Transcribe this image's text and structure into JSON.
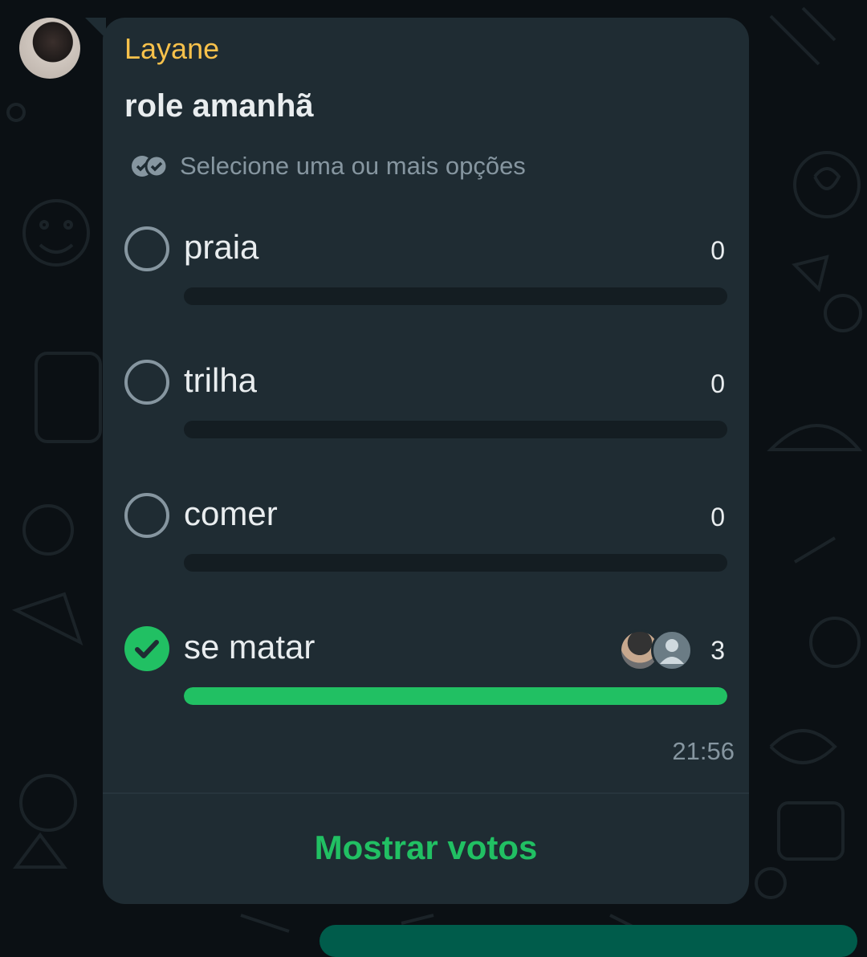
{
  "message": {
    "sender": "Layane",
    "sender_color": "#f7c14b",
    "poll": {
      "question": "role amanhã",
      "hint": "Selecione uma ou mais opções",
      "options": [
        {
          "label": "praia",
          "votes": "0",
          "fill": 0,
          "checked": false
        },
        {
          "label": "trilha",
          "votes": "0",
          "fill": 0,
          "checked": false
        },
        {
          "label": "comer",
          "votes": "0",
          "fill": 0,
          "checked": false
        },
        {
          "label": "se matar",
          "votes": "3",
          "fill": 1,
          "checked": true
        }
      ]
    },
    "time": "21:56",
    "show_votes_label": "Mostrar votos"
  },
  "colors": {
    "accent": "#21c063",
    "bubble": "#1f2c33",
    "background": "#0b1014"
  }
}
